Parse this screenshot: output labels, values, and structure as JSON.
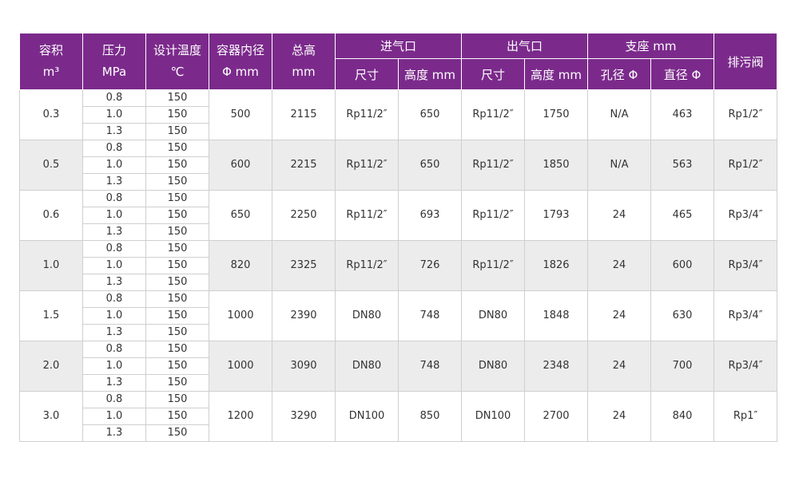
{
  "header": {
    "vol_l1": "容积",
    "vol_l2": "m³",
    "press_l1": "压力",
    "press_l2": "MPa",
    "temp_l1": "设计温度",
    "temp_l2": "℃",
    "dia_l1": "容器内径",
    "dia_l2": "Φ mm",
    "height_l1": "总高",
    "height_l2": "mm",
    "inlet": "进气口",
    "outlet": "出气口",
    "support": "支座 mm",
    "drain": "排污阀",
    "inlet_size": "尺寸",
    "inlet_height": "高度 mm",
    "outlet_size": "尺寸",
    "outlet_height": "高度 mm",
    "support_hole": "孔径 Φ",
    "support_dia": "直径 Φ"
  },
  "rows": [
    {
      "volume": "0.3",
      "pressures": [
        "0.8",
        "1.0",
        "1.3"
      ],
      "temps": [
        "150",
        "150",
        "150"
      ],
      "diameter": "500",
      "total_height": "2115",
      "inlet_size": "Rp11/2″",
      "inlet_height": "650",
      "outlet_size": "Rp11/2″",
      "outlet_height": "1750",
      "hole": "N/A",
      "support_dia": "463",
      "drain": "Rp1/2″"
    },
    {
      "volume": "0.5",
      "pressures": [
        "0.8",
        "1.0",
        "1.3"
      ],
      "temps": [
        "150",
        "150",
        "150"
      ],
      "diameter": "600",
      "total_height": "2215",
      "inlet_size": "Rp11/2″",
      "inlet_height": "650",
      "outlet_size": "Rp11/2″",
      "outlet_height": "1850",
      "hole": "N/A",
      "support_dia": "563",
      "drain": "Rp1/2″"
    },
    {
      "volume": "0.6",
      "pressures": [
        "0.8",
        "1.0",
        "1.3"
      ],
      "temps": [
        "150",
        "150",
        "150"
      ],
      "diameter": "650",
      "total_height": "2250",
      "inlet_size": "Rp11/2″",
      "inlet_height": "693",
      "outlet_size": "Rp11/2″",
      "outlet_height": "1793",
      "hole": "24",
      "support_dia": "465",
      "drain": "Rp3/4″"
    },
    {
      "volume": "1.0",
      "pressures": [
        "0.8",
        "1.0",
        "1.3"
      ],
      "temps": [
        "150",
        "150",
        "150"
      ],
      "diameter": "820",
      "total_height": "2325",
      "inlet_size": "Rp11/2″",
      "inlet_height": "726",
      "outlet_size": "Rp11/2″",
      "outlet_height": "1826",
      "hole": "24",
      "support_dia": "600",
      "drain": "Rp3/4″"
    },
    {
      "volume": "1.5",
      "pressures": [
        "0.8",
        "1.0",
        "1.3"
      ],
      "temps": [
        "150",
        "150",
        "150"
      ],
      "diameter": "1000",
      "total_height": "2390",
      "inlet_size": "DN80",
      "inlet_height": "748",
      "outlet_size": "DN80",
      "outlet_height": "1848",
      "hole": "24",
      "support_dia": "630",
      "drain": "Rp3/4″"
    },
    {
      "volume": "2.0",
      "pressures": [
        "0.8",
        "1.0",
        "1.3"
      ],
      "temps": [
        "150",
        "150",
        "150"
      ],
      "diameter": "1000",
      "total_height": "3090",
      "inlet_size": "DN80",
      "inlet_height": "748",
      "outlet_size": "DN80",
      "outlet_height": "2348",
      "hole": "24",
      "support_dia": "700",
      "drain": "Rp3/4″"
    },
    {
      "volume": "3.0",
      "pressures": [
        "0.8",
        "1.0",
        "1.3"
      ],
      "temps": [
        "150",
        "150",
        "150"
      ],
      "diameter": "1200",
      "total_height": "3290",
      "inlet_size": "DN100",
      "inlet_height": "850",
      "outlet_size": "DN100",
      "outlet_height": "2700",
      "hole": "24",
      "support_dia": "840",
      "drain": "Rp1″"
    }
  ],
  "colors": {
    "header_bg": "#7b2a8b",
    "header_text": "#ffffff",
    "alt_row_bg": "#ececec"
  }
}
